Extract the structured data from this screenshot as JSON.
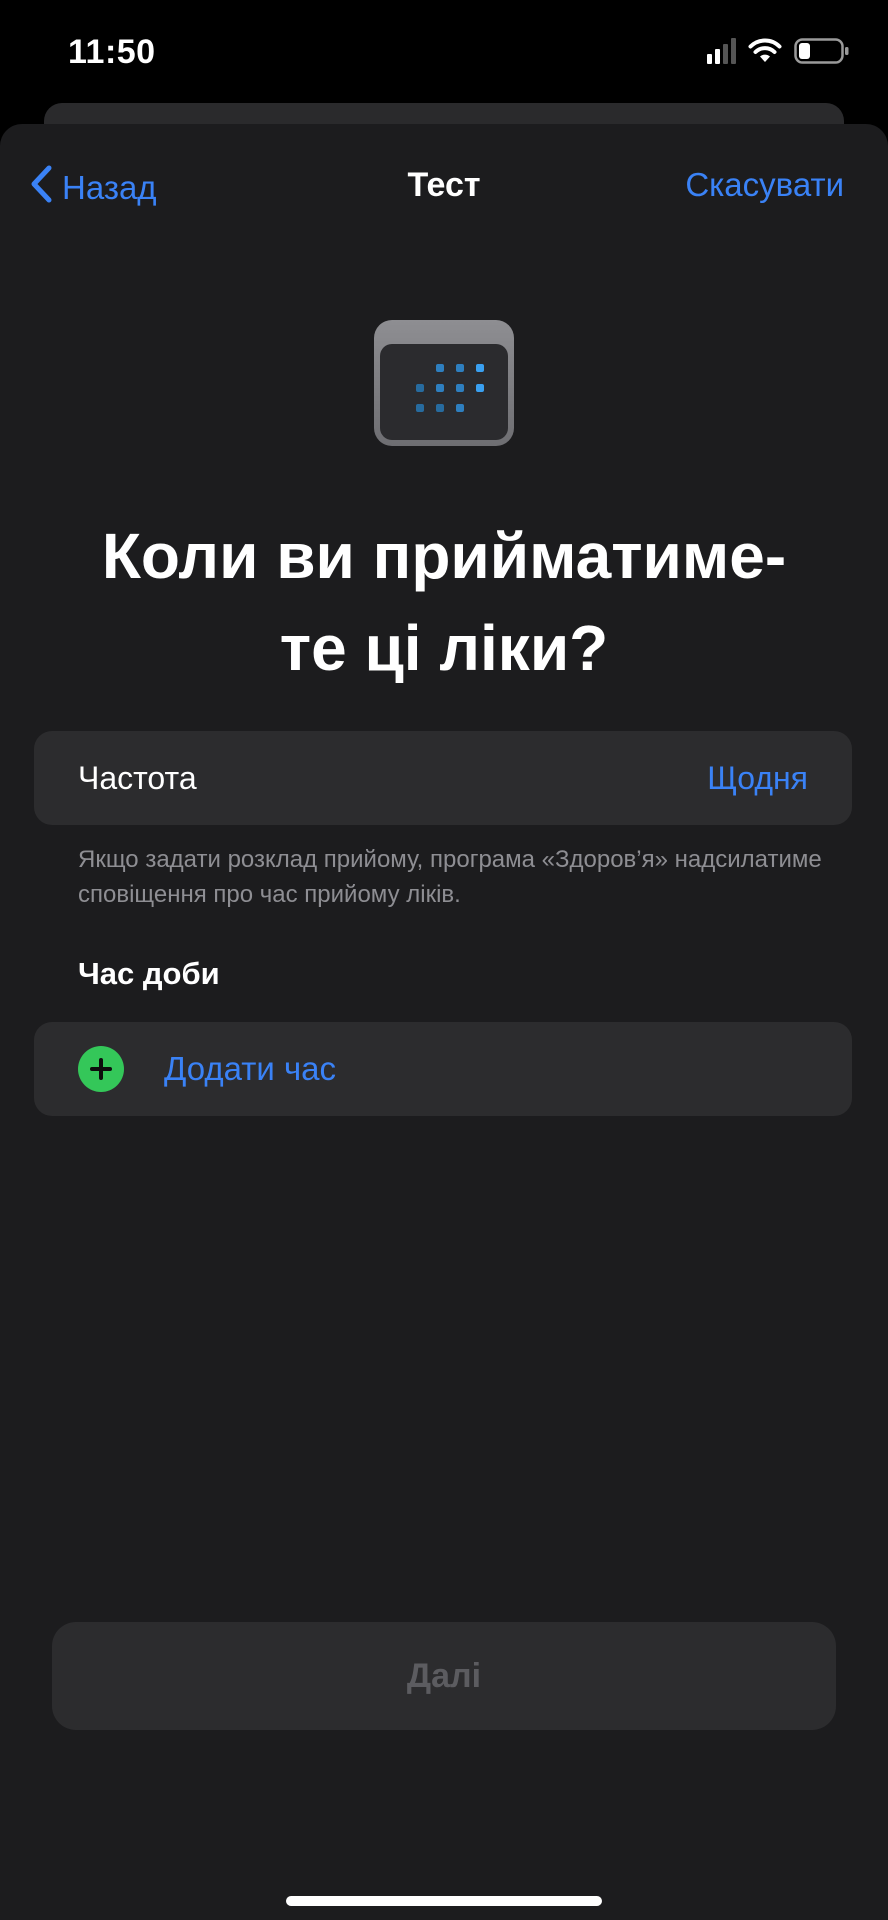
{
  "status_bar": {
    "time": "11:50",
    "signal_icon": "cellular-signal-icon",
    "wifi_icon": "wifi-icon",
    "battery_icon": "battery-icon",
    "battery_level": 0.25
  },
  "nav": {
    "back_label": "Назад",
    "back_icon": "chevron-left-icon",
    "title": "Тест",
    "cancel_label": "Скасувати"
  },
  "header_icon": "calendar-icon",
  "heading": {
    "line1": "Коли ви прийматиме-",
    "line2": "те ці ліки?"
  },
  "frequency": {
    "label": "Частота",
    "value": "Щодня"
  },
  "footnote": "Якщо задати розклад прийому, програма «Здоров’я» надсилатиме сповіщення про час прийому ліків.",
  "time_of_day": {
    "title": "Час доби",
    "add_label": "Додати час",
    "add_icon": "plus-circle-icon"
  },
  "next_button": {
    "label": "Далі",
    "enabled": false
  },
  "colors": {
    "accent": "#3a82f6",
    "add_green": "#34c759",
    "background": "#1c1c1e",
    "cell": "#2c2c2e"
  }
}
